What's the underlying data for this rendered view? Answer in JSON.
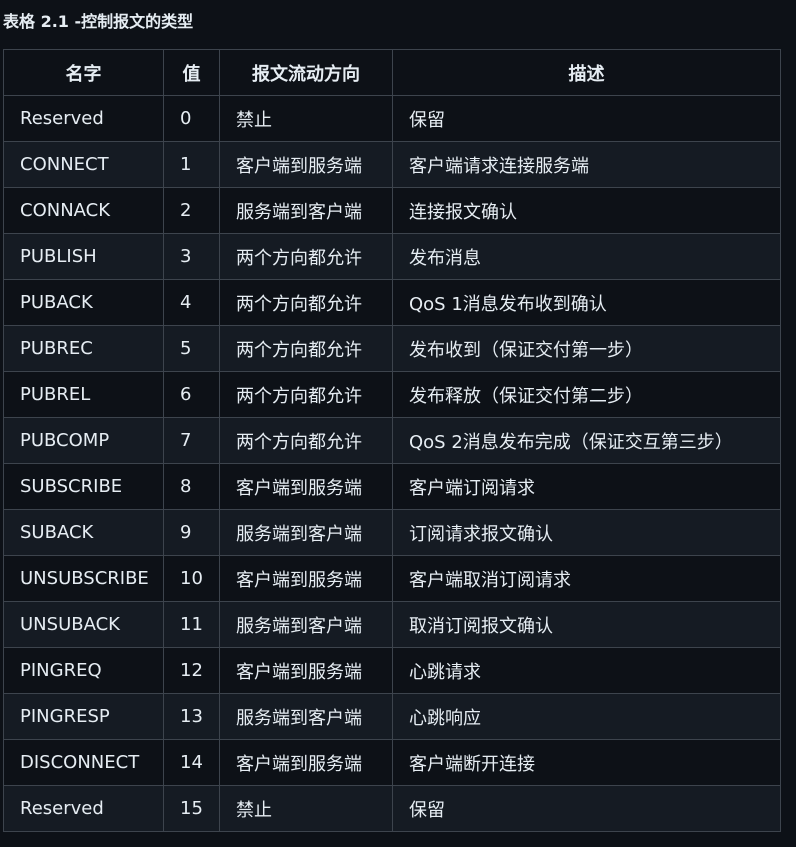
{
  "caption": "表格 2.1 -控制报文的类型",
  "table": {
    "headers": [
      "名字",
      "值",
      "报文流动方向",
      "描述"
    ],
    "rows": [
      [
        "Reserved",
        "0",
        "禁止",
        "保留"
      ],
      [
        "CONNECT",
        "1",
        "客户端到服务端",
        "客户端请求连接服务端"
      ],
      [
        "CONNACK",
        "2",
        "服务端到客户端",
        "连接报文确认"
      ],
      [
        "PUBLISH",
        "3",
        "两个方向都允许",
        "发布消息"
      ],
      [
        "PUBACK",
        "4",
        "两个方向都允许",
        "QoS 1消息发布收到确认"
      ],
      [
        "PUBREC",
        "5",
        "两个方向都允许",
        "发布收到（保证交付第一步）"
      ],
      [
        "PUBREL",
        "6",
        "两个方向都允许",
        "发布释放（保证交付第二步）"
      ],
      [
        "PUBCOMP",
        "7",
        "两个方向都允许",
        "QoS 2消息发布完成（保证交互第三步）"
      ],
      [
        "SUBSCRIBE",
        "8",
        "客户端到服务端",
        "客户端订阅请求"
      ],
      [
        "SUBACK",
        "9",
        "服务端到客户端",
        "订阅请求报文确认"
      ],
      [
        "UNSUBSCRIBE",
        "10",
        "客户端到服务端",
        "客户端取消订阅请求"
      ],
      [
        "UNSUBACK",
        "11",
        "服务端到客户端",
        "取消订阅报文确认"
      ],
      [
        "PINGREQ",
        "12",
        "客户端到服务端",
        "心跳请求"
      ],
      [
        "PINGRESP",
        "13",
        "服务端到客户端",
        "心跳响应"
      ],
      [
        "DISCONNECT",
        "14",
        "客户端到服务端",
        "客户端断开连接"
      ],
      [
        "Reserved",
        "15",
        "禁止",
        "保留"
      ]
    ]
  }
}
